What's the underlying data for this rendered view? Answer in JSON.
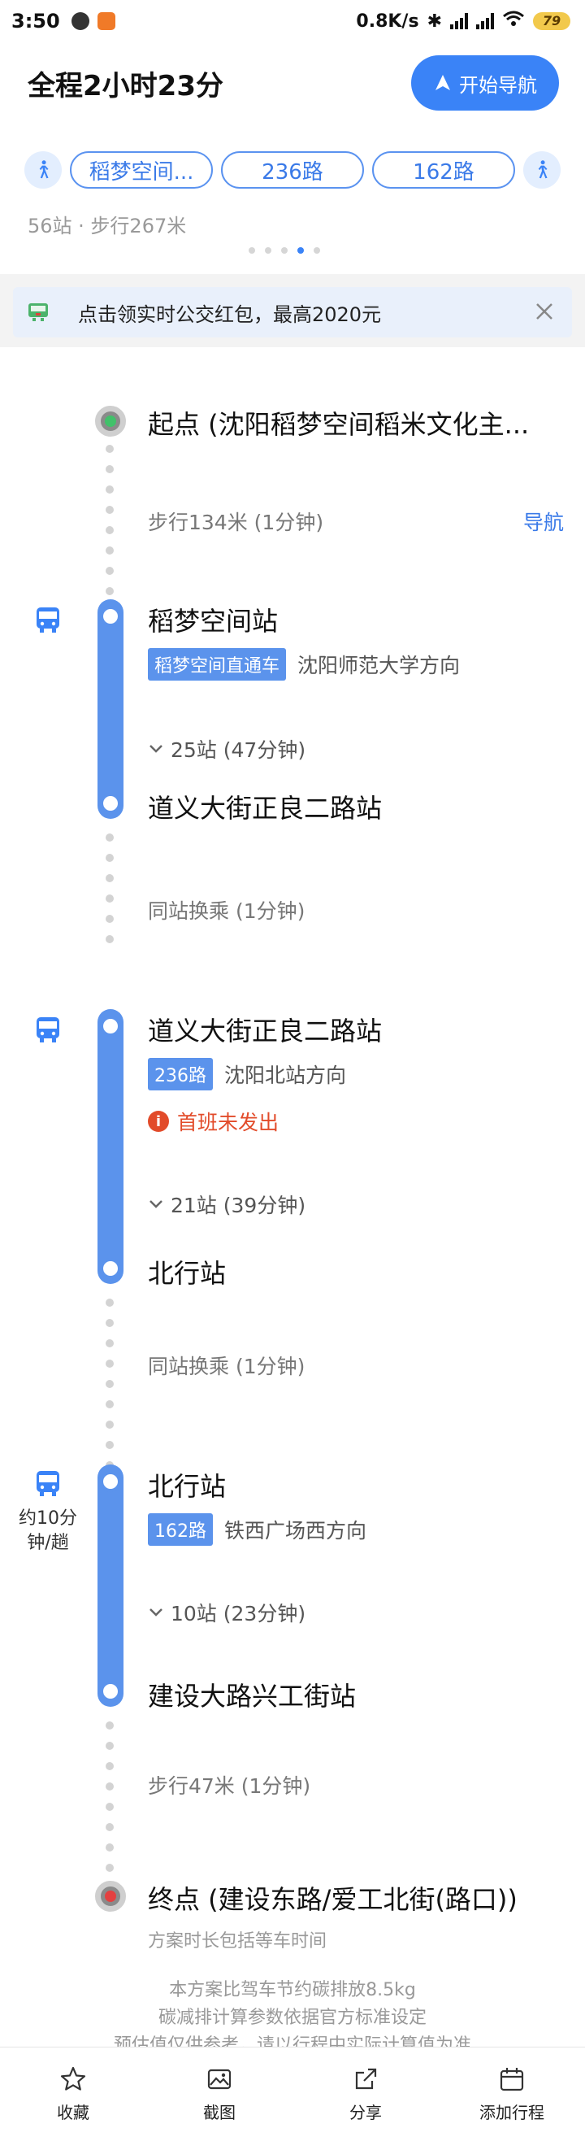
{
  "status_bar": {
    "time": "3:50",
    "net_speed": "0.8K/s",
    "battery": "79"
  },
  "header": {
    "total_time": "全程2小时23分",
    "nav_button": "开始导航",
    "segments": [
      "稻梦空间...",
      "236路",
      "162路"
    ],
    "summary": "56站 · 步行267米",
    "page_dots": 5,
    "active_dot": 3
  },
  "promo": {
    "text": "点击领实时公交红包，最高2020元"
  },
  "route": {
    "start": "起点 (沈阳稻梦空间稻米文化主...",
    "walk1": "步行134米 (1分钟)",
    "walk1_link": "导航",
    "leg1": {
      "board": "稻梦空间站",
      "line": "稻梦空间直通车",
      "direction": "沈阳师范大学方向",
      "stops": "25站 (47分钟)",
      "alight": "道义大街正良二路站"
    },
    "transfer1": "同站换乘 (1分钟)",
    "leg2": {
      "board": "道义大街正良二路站",
      "line": "236路",
      "direction": "沈阳北站方向",
      "warning": "首班未发出",
      "stops": "21站 (39分钟)",
      "alight": "北行站"
    },
    "transfer2": "同站换乘 (1分钟)",
    "leg3": {
      "frequency": "约10分钟/趟",
      "board": "北行站",
      "line": "162路",
      "direction": "铁西广场西方向",
      "stops": "10站 (23分钟)",
      "alight": "建设大路兴工街站"
    },
    "walk2": "步行47米 (1分钟)",
    "end": "终点 (建设东路/爱工北街(路口))",
    "end_note": "方案时长包括等车时间",
    "carbon_line1": "本方案比驾车节约碳排放8.5kg",
    "carbon_line2": "碳减排计算参数依据官方标准设定",
    "carbon_line3": "预估值仅供参考，请以行程中实际计算值为准"
  },
  "bottom_bar": {
    "favorite": "收藏",
    "screenshot": "截图",
    "share": "分享",
    "add_trip": "添加行程"
  },
  "colors": {
    "accent": "#3a83f7",
    "line_blue": "#5b93ec",
    "warning": "#e24b2a"
  }
}
